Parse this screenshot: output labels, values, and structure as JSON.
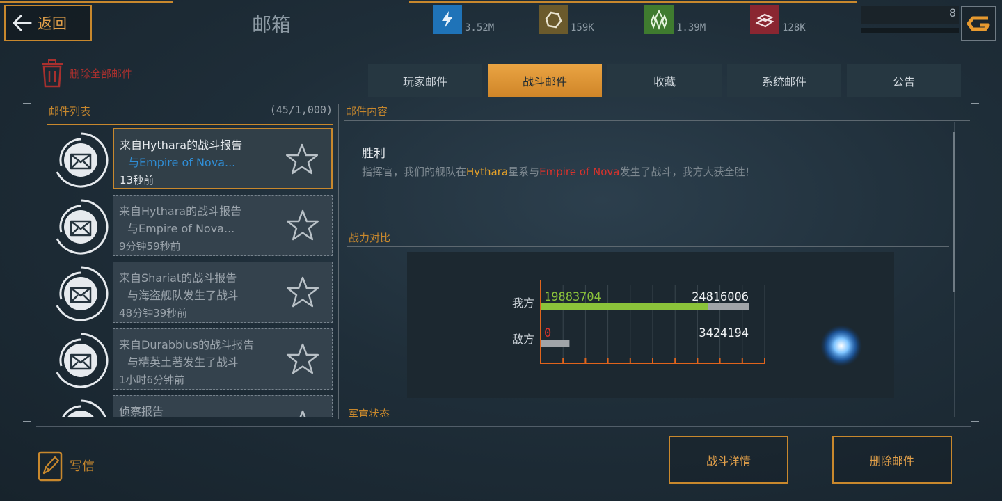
{
  "header": {
    "back_label": "返回",
    "title": "邮箱",
    "resources": [
      {
        "icon": "energy-icon",
        "value": "3.52M",
        "color": "#1f73b8"
      },
      {
        "icon": "ore-icon",
        "value": "159K",
        "color": "#6b5a2c"
      },
      {
        "icon": "crystal-icon",
        "value": "1.39M",
        "color": "#3f7b2f"
      },
      {
        "icon": "ingot-icon",
        "value": "128K",
        "color": "#8a2631"
      }
    ],
    "level": "8"
  },
  "toolbar": {
    "delete_all_label": "删除全部邮件"
  },
  "tabs": [
    {
      "label": "玩家邮件",
      "active": false
    },
    {
      "label": "战斗邮件",
      "active": true
    },
    {
      "label": "收藏",
      "active": false
    },
    {
      "label": "系统邮件",
      "active": false
    },
    {
      "label": "公告",
      "active": false
    }
  ],
  "mail_list": {
    "title": "邮件列表",
    "count": "(45/1,000)",
    "items": [
      {
        "line1": "来自Hythara的战斗报告",
        "line2": "与Empire of Nova...",
        "time": "13秒前",
        "selected": true
      },
      {
        "line1": "来自Hythara的战斗报告",
        "line2": "与Empire of Nova...",
        "time": "9分钟59秒前",
        "selected": false
      },
      {
        "line1": "来自Shariat的战斗报告",
        "line2": "与海盗舰队发生了战斗",
        "time": "48分钟39秒前",
        "selected": false
      },
      {
        "line1": "来自Durabbius的战斗报告",
        "line2": "与精英土著发生了战斗",
        "time": "1小时6分钟前",
        "selected": false
      },
      {
        "line1": "侦察报告",
        "line2": "",
        "time": "",
        "selected": false
      }
    ]
  },
  "content": {
    "title": "邮件内容",
    "result": "胜利",
    "message": {
      "prefix": "指挥官，我们的舰队在",
      "system": "Hythara",
      "middle": "星系与",
      "enemy": "Empire of Nova",
      "suffix": "发生了战斗，我方大获全胜！"
    },
    "comparison_title": "战力对比",
    "army_status_title": "军官状态"
  },
  "chart_data": {
    "type": "bar",
    "orientation": "horizontal",
    "categories": [
      "我方",
      "敌方"
    ],
    "series": [
      {
        "values": [
          19883704,
          0
        ],
        "color": "#8bc33a"
      },
      {
        "values": [
          24816006,
          3424194
        ],
        "color": "#a0a4a8"
      }
    ],
    "labels": {
      "ours_remaining": "19883704",
      "ours_total": "24816006",
      "enemy_remaining": "0",
      "enemy_total": "3424194"
    },
    "axis_color": "#e0641c",
    "grid": true
  },
  "footer": {
    "write_label": "写信",
    "battle_detail_label": "战斗详情",
    "delete_mail_label": "删除邮件"
  }
}
